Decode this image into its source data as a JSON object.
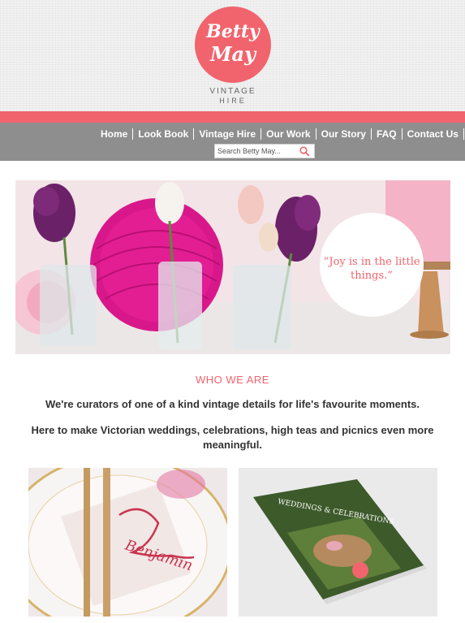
{
  "brand": {
    "logo_line1": "Betty",
    "logo_line2": "May",
    "tagline1": "VINTAGE",
    "tagline2": "HIRE",
    "accent_color": "#f1646d"
  },
  "nav": {
    "items": [
      "Home",
      "Look Book",
      "Vintage Hire",
      "Our Work",
      "Our Story",
      "FAQ",
      "Contact Us"
    ]
  },
  "search": {
    "placeholder": "Search Betty May...",
    "icon": "search-icon"
  },
  "hero": {
    "quote": "“Joy is in the little things.”"
  },
  "who_we_are": {
    "title": "WHO WE ARE",
    "paragraph1": "We're curators of one of a kind vintage details for life's favourite moments.",
    "paragraph2": "Here to make Victorian weddings, celebrations, high teas and picnics even more meaningful."
  },
  "thumbnails": {
    "left_caption": "Benjamin",
    "right_brochure_title": "WEDDINGS & CELEBRATIONS"
  }
}
